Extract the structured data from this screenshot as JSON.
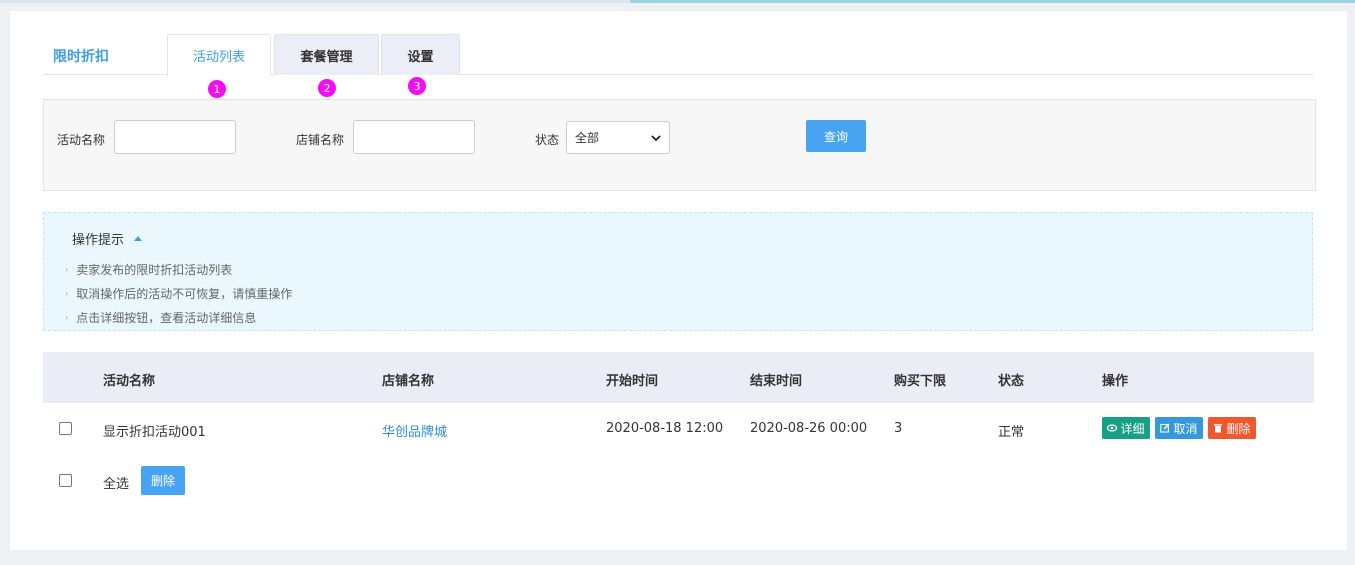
{
  "header": {
    "brand": "限时折扣",
    "tabs": [
      {
        "label": "活动列表",
        "active": true,
        "marker": "1"
      },
      {
        "label": "套餐管理",
        "active": false,
        "marker": "2"
      },
      {
        "label": "设置",
        "active": false,
        "marker": "3"
      }
    ]
  },
  "search": {
    "activity_name_label": "活动名称",
    "activity_name_value": "",
    "shop_name_label": "店铺名称",
    "shop_name_value": "",
    "status_label": "状态",
    "status_selected": "全部",
    "query_label": "查询"
  },
  "tips": {
    "title": "操作提示",
    "items": [
      "卖家发布的限时折扣活动列表",
      "取消操作后的活动不可恢复，请慎重操作",
      "点击详细按钮，查看活动详细信息"
    ]
  },
  "table": {
    "columns": [
      "活动名称",
      "店铺名称",
      "开始时间",
      "结束时间",
      "购买下限",
      "状态",
      "操作"
    ],
    "rows": [
      {
        "name": "显示折扣活动001",
        "shop": "华创品牌城",
        "start": "2020-08-18 12:00",
        "end": "2020-08-26 00:00",
        "min_buy": "3",
        "status": "正常",
        "actions": {
          "detail": "详细",
          "cancel": "取消",
          "delete": "删除"
        }
      }
    ]
  },
  "footer": {
    "select_all_label": "全选",
    "delete_label": "删除"
  },
  "colors": {
    "accent": "#3d9fe6",
    "detail": "#16a085",
    "cancel": "#3498db",
    "delete": "#f0572d",
    "marker": "#f20ef2"
  }
}
